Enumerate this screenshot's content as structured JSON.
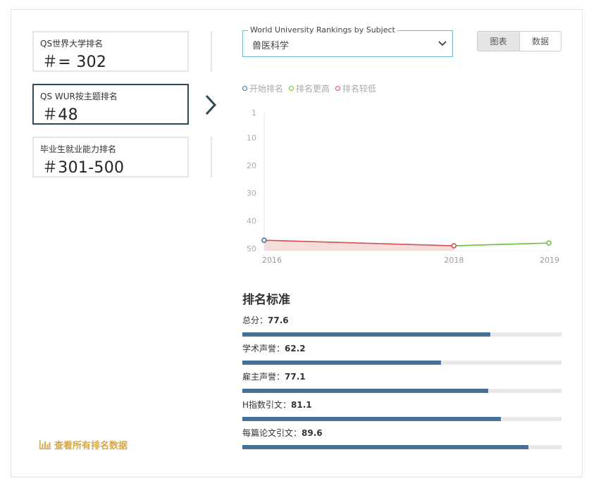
{
  "ranks": [
    {
      "label": "QS世界大学排名",
      "value": "＃= 302"
    },
    {
      "label": "QS WUR按主题排名",
      "value": "＃48"
    },
    {
      "label": "毕业生就业能力排名",
      "value": "＃301-500"
    }
  ],
  "view_all": "查看所有排名数据",
  "subject_select": {
    "legend": "World University Rankings by Subject",
    "value": "兽医科学"
  },
  "toggle": {
    "chart": "图表",
    "data": "数据"
  },
  "legend": [
    {
      "label": "开始排名",
      "color": "#46719a"
    },
    {
      "label": "排名更高",
      "color": "#6cbf3b"
    },
    {
      "label": "排名较低",
      "color": "#d0534f"
    }
  ],
  "chart_data": {
    "type": "line",
    "x": [
      2016,
      2018,
      2019
    ],
    "y": [
      47,
      49,
      48
    ],
    "y_ticks": [
      1,
      10,
      20,
      30,
      40,
      50
    ],
    "ylim": [
      1,
      50
    ],
    "y_reversed": true,
    "x_tick_labels": [
      "2016",
      "2018",
      "2019"
    ]
  },
  "criteria_title": "排名标准",
  "criteria": [
    {
      "label": "总分：",
      "value": "77.6",
      "score": 77.6
    },
    {
      "label": "学术声誉：",
      "value": "62.2",
      "score": 62.2
    },
    {
      "label": "雇主声誉：",
      "value": "77.1",
      "score": 77.1
    },
    {
      "label": "H指数引文：",
      "value": "81.1",
      "score": 81.1
    },
    {
      "label": "每篇论文引文：",
      "value": "89.6",
      "score": 89.6
    }
  ]
}
